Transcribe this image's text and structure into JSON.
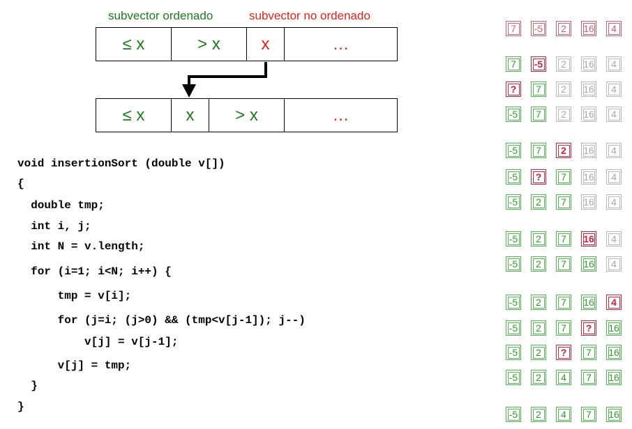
{
  "legend": {
    "sorted_label": "subvector ordenado",
    "unsorted_label": "subvector no ordenado"
  },
  "top_vector": [
    "≤ x",
    "> x",
    "x",
    "…"
  ],
  "bottom_vector": [
    "≤ x",
    "x",
    "> x",
    "…"
  ],
  "code": [
    "void insertionSort (double v[])",
    "{",
    "  double tmp;",
    "  int i, j;",
    "  int N = v.length;",
    "  for (i=1; i<N; i++) {",
    "      tmp = v[i];",
    "      for (j=i; (j>0) && (tmp<v[j-1]); j--)",
    "          v[j] = v[j-1];",
    "      v[j] = tmp;",
    "  }",
    "}"
  ],
  "colors": {
    "sorted": "#1f7a1f",
    "unsorted": "#e2231a",
    "trace_initial": "#d06070",
    "trace_sorted": "#4cbb4c",
    "trace_active": "#d0213a",
    "trace_pending": "#b8b8b8"
  },
  "trace_rows": [
    {
      "values": [
        "7",
        "-5",
        "2",
        "16",
        "4"
      ],
      "states": [
        "pink",
        "pink",
        "pink",
        "pink",
        "pink"
      ]
    },
    {
      "values": [
        "7",
        "-5",
        "2",
        "16",
        "4"
      ],
      "states": [
        "green",
        "red",
        "gray",
        "gray",
        "gray"
      ]
    },
    {
      "values": [
        "?",
        "7",
        "2",
        "16",
        "4"
      ],
      "states": [
        "red",
        "green",
        "gray",
        "gray",
        "gray"
      ]
    },
    {
      "values": [
        "-5",
        "7",
        "2",
        "16",
        "4"
      ],
      "states": [
        "green",
        "green",
        "gray",
        "gray",
        "gray"
      ]
    },
    {
      "values": [
        "-5",
        "7",
        "2",
        "16",
        "4"
      ],
      "states": [
        "green",
        "green",
        "red",
        "gray",
        "gray"
      ]
    },
    {
      "values": [
        "-5",
        "?",
        "7",
        "16",
        "4"
      ],
      "states": [
        "green",
        "red",
        "green",
        "gray",
        "gray"
      ]
    },
    {
      "values": [
        "-5",
        "2",
        "7",
        "16",
        "4"
      ],
      "states": [
        "green",
        "green",
        "green",
        "gray",
        "gray"
      ]
    },
    {
      "values": [
        "-5",
        "2",
        "7",
        "16",
        "4"
      ],
      "states": [
        "green",
        "green",
        "green",
        "red",
        "gray"
      ]
    },
    {
      "values": [
        "-5",
        "2",
        "7",
        "16",
        "4"
      ],
      "states": [
        "green",
        "green",
        "green",
        "green",
        "gray"
      ]
    },
    {
      "values": [
        "-5",
        "2",
        "7",
        "16",
        "4"
      ],
      "states": [
        "green",
        "green",
        "green",
        "green",
        "red"
      ]
    },
    {
      "values": [
        "-5",
        "2",
        "7",
        "?",
        "16"
      ],
      "states": [
        "green",
        "green",
        "green",
        "red",
        "green"
      ]
    },
    {
      "values": [
        "-5",
        "2",
        "?",
        "7",
        "16"
      ],
      "states": [
        "green",
        "green",
        "red",
        "green",
        "green"
      ]
    },
    {
      "values": [
        "-5",
        "2",
        "4",
        "7",
        "16"
      ],
      "states": [
        "green",
        "green",
        "green",
        "green",
        "green"
      ]
    },
    {
      "values": [
        "-5",
        "2",
        "4",
        "7",
        "16"
      ],
      "states": [
        "green",
        "green",
        "green",
        "green",
        "green"
      ]
    }
  ]
}
